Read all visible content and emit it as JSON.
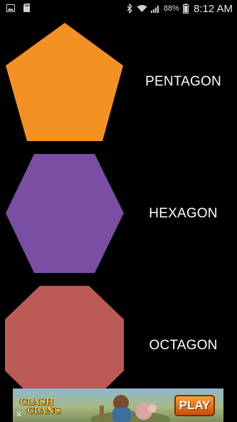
{
  "status_bar": {
    "left_icons": [
      "image-icon",
      "sd-card-icon"
    ],
    "right_icons": [
      "bluetooth-icon",
      "wifi-icon",
      "signal-icon",
      "battery-icon"
    ],
    "battery_percent": "88%",
    "time": "8:12 AM"
  },
  "shapes": [
    {
      "name": "pentagon",
      "label": "PENTAGON",
      "color": "#F39122"
    },
    {
      "name": "hexagon",
      "label": "HEXAGON",
      "color": "#7A4FA3"
    },
    {
      "name": "octagon",
      "label": "OCTAGON",
      "color": "#BC5A55"
    }
  ],
  "ad": {
    "logo_line1": "CLASH",
    "logo_line2": "CLANS",
    "cta": "PLAY",
    "close": "✕",
    "cta_color": "#E66A12"
  },
  "colors": {
    "background": "#000000",
    "label_text": "#FFFFFF"
  }
}
